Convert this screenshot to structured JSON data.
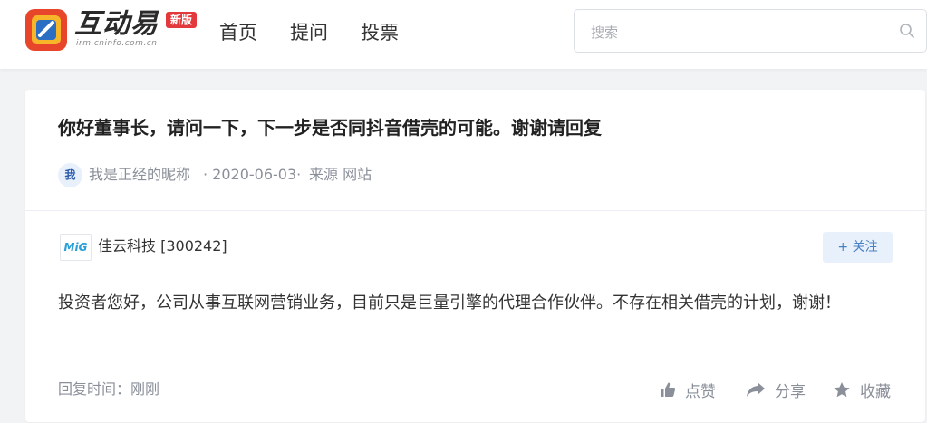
{
  "header": {
    "brand": "互动易",
    "brand_sub": "irm.cninfo.com.cn",
    "badge": "新版",
    "nav": [
      "首页",
      "提问",
      "投票"
    ],
    "search_placeholder": "搜索"
  },
  "question": {
    "title": "你好董事长，请问一下，下一步是否同抖音借壳的可能。谢谢请回复",
    "asker_avatar": "我",
    "asker": "我是正经的昵称",
    "date": "· 2020-06-03·",
    "source": "来源 网站"
  },
  "answer": {
    "company_logo": "MiG",
    "company": "佳云科技 [300242]",
    "follow_label": "+ 关注",
    "text": "投资者您好，公司从事互联网营销业务，目前只是巨量引擎的代理合作伙伴。不存在相关借壳的计划，谢谢！",
    "reply_time": "回复时间：刚刚",
    "actions": {
      "like": "点赞",
      "share": "分享",
      "favorite": "收藏"
    }
  },
  "colors": {
    "accent": "#4a7fc1",
    "badge": "#e4393c",
    "page_bg": "#f2f3f5"
  },
  "icons": [
    "logo-icon",
    "search-icon",
    "thumbs-up-icon",
    "share-icon",
    "star-icon"
  ]
}
